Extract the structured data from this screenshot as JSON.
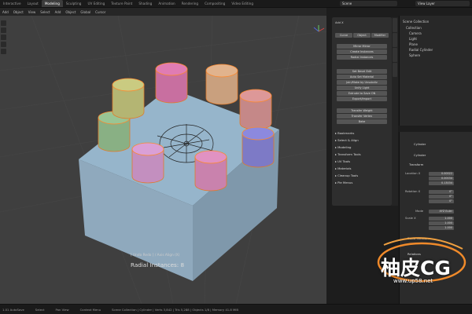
{
  "topbar": {
    "tabs": [
      "Interactive",
      "Layout",
      "Modeling",
      "Sculpting",
      "UV Editing",
      "Texture Paint",
      "Shading",
      "Animation",
      "Rendering",
      "Compositing",
      "Video Editing"
    ],
    "active_tab": "Modeling",
    "scene": "Scene",
    "view_layer": "View Layer"
  },
  "viewport_header": {
    "mode": "Add",
    "items": [
      "Object",
      "View",
      "Select",
      "Add",
      "Object"
    ],
    "orientation": "Global",
    "pivot": "Cursor"
  },
  "viewport": {
    "status": "[ Undo  Redo ]  /  Axis Align (X)",
    "radial": "Radial Instances: 8",
    "cylinder_colors": [
      "#c86fa0",
      "#c9a07e",
      "#c58888",
      "#7d7ac6",
      "#c982ad",
      "#c38fbf",
      "#89b084",
      "#b4b573"
    ]
  },
  "npanel": {
    "header": "Add X",
    "tabs": [
      "Item",
      "Tool",
      "View",
      "Edit"
    ],
    "row1": [
      "Curve",
      "Object",
      "Modifier"
    ],
    "buttons_a": [
      "Mirror Mirror",
      "Create Instances",
      "Radial Instances"
    ],
    "buttons_b": [
      "Set Bevel Edit",
      "Auto Set Material",
      "Join/Make by Unsubdiv",
      "Unify Light",
      "Extrude to Save ON",
      "Export/Import"
    ],
    "buttons_c": [
      "Transfer Weight",
      "Transfer Vertex",
      "Bake"
    ],
    "sections": [
      "Bookmarks",
      "Select & Align",
      "Modeling",
      "Transform Tools",
      "UV Tools",
      "Materials",
      "Cleanup Tools",
      "Pie Menus"
    ]
  },
  "outliner": {
    "title": "Scene Collection",
    "rows": [
      "Collection",
      "Camera",
      "Light",
      "Plane",
      "Radial Cylinder",
      "Sphere"
    ]
  },
  "properties": {
    "object_name": "Cylinder",
    "sub_name": "Cylinder",
    "section": "Transform",
    "location": {
      "label": "Location X",
      "x": "0.00022",
      "y": "0.00034",
      "z": "0.13034"
    },
    "rotation": {
      "label": "Rotation X",
      "x": "0°",
      "y": "0°",
      "z": "0°"
    },
    "mode_label": "Mode",
    "mode_value": "XYZ Euler",
    "scale": {
      "label": "Scale X",
      "x": "1.000",
      "y": "1.000",
      "z": "1.000"
    },
    "delta": "Delta Transform",
    "relations": "Relations"
  },
  "statusbar": {
    "items": [
      "1.01 AutoSave",
      "Select",
      "Pan View",
      "Context Menu",
      "Scene Collection | Cylinder | Verts 3,842 | Tris 5,288 | Objects 1/8 | Memory 41.8 MiB"
    ]
  },
  "watermark": {
    "text": "柚皮CG",
    "url": "www.up58.net"
  }
}
